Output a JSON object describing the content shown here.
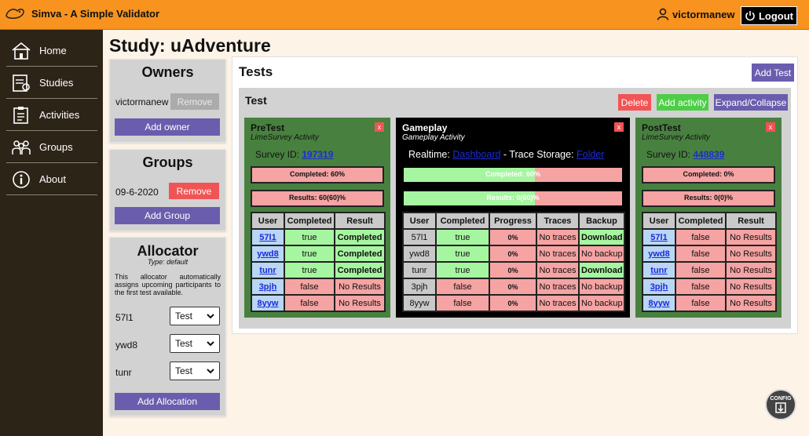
{
  "header": {
    "title": "Simva - A Simple Validator",
    "username": "victormanew",
    "logout_label": "Logout"
  },
  "sidebar": {
    "items": [
      {
        "label": "Home",
        "icon": "home-icon"
      },
      {
        "label": "Studies",
        "icon": "studies-icon"
      },
      {
        "label": "Activities",
        "icon": "activities-icon"
      },
      {
        "label": "Groups",
        "icon": "groups-icon"
      },
      {
        "label": "About",
        "icon": "about-icon"
      }
    ]
  },
  "page_title": "Study: uAdventure",
  "owners": {
    "title": "Owners",
    "owner_name": "victormanew",
    "remove_label": "Remove",
    "add_label": "Add owner"
  },
  "groups": {
    "title": "Groups",
    "group_name": "09-6-2020",
    "remove_label": "Remove",
    "add_label": "Add Group"
  },
  "allocator": {
    "title": "Allocator",
    "type": "Type: default",
    "description": "This allocator automatically assigns upcoming participants to the first test available.",
    "rows": [
      {
        "user": "57l1",
        "value": "Test"
      },
      {
        "user": "ywd8",
        "value": "Test"
      },
      {
        "user": "tunr",
        "value": "Test"
      }
    ],
    "add_label": "Add Allocation"
  },
  "tests": {
    "title": "Tests",
    "add_label": "Add Test",
    "test_name": "Test",
    "delete_label": "Delete",
    "add_activity_label": "Add activity",
    "expand_label": "Expand/Collapse",
    "pretest": {
      "title": "PreTest",
      "subtitle": "LimeSurvey Activity",
      "close": "x",
      "survey_label": "Survey ID: ",
      "survey_id": "197319",
      "completed_text": "Completed: 60%",
      "completed_fraction": 0.0,
      "results_text": "Results: 60(60)%",
      "headers": [
        "User",
        "Completed",
        "Result"
      ],
      "rows": [
        {
          "user": "57l1",
          "completed": "true",
          "result": "Completed"
        },
        {
          "user": "ywd8",
          "completed": "true",
          "result": "Completed"
        },
        {
          "user": "tunr",
          "completed": "true",
          "result": "Completed"
        },
        {
          "user": "3pjh",
          "completed": "false",
          "result": "No Results"
        },
        {
          "user": "8yyw",
          "completed": "false",
          "result": "No Results"
        }
      ]
    },
    "gameplay": {
      "title": "Gameplay",
      "subtitle": "Gameplay Activity",
      "close": "x",
      "realtime_label": "Realtime: ",
      "dashboard_link": "Dashboard",
      "storage_label": " - Trace Storage: ",
      "folder_link": "Folder",
      "completed_text": "Completed: 60%",
      "completed_fraction": 0.6,
      "results_text": "Results: 0(60)%",
      "results_fraction": 0.6,
      "headers": [
        "User",
        "Completed",
        "Progress",
        "Traces",
        "Backup"
      ],
      "rows": [
        {
          "user": "57l1",
          "completed": "true",
          "progress": "0%",
          "traces": "No traces",
          "backup": "Download"
        },
        {
          "user": "ywd8",
          "completed": "true",
          "progress": "0%",
          "traces": "No traces",
          "backup": "No backup"
        },
        {
          "user": "tunr",
          "completed": "true",
          "progress": "0%",
          "traces": "No traces",
          "backup": "Download"
        },
        {
          "user": "3pjh",
          "completed": "false",
          "progress": "0%",
          "traces": "No traces",
          "backup": "No backup"
        },
        {
          "user": "8yyw",
          "completed": "false",
          "progress": "0%",
          "traces": "No traces",
          "backup": "No backup"
        }
      ]
    },
    "posttest": {
      "title": "PostTest",
      "subtitle": "LimeSurvey Activity",
      "close": "x",
      "survey_label": "Survey ID: ",
      "survey_id": "448839",
      "completed_text": "Completed: 0%",
      "results_text": "Results: 0(0)%",
      "headers": [
        "User",
        "Completed",
        "Result"
      ],
      "rows": [
        {
          "user": "57l1",
          "completed": "false",
          "result": "No Results"
        },
        {
          "user": "ywd8",
          "completed": "false",
          "result": "No Results"
        },
        {
          "user": "tunr",
          "completed": "false",
          "result": "No Results"
        },
        {
          "user": "3pjh",
          "completed": "false",
          "result": "No Results"
        },
        {
          "user": "8yyw",
          "completed": "false",
          "result": "No Results"
        }
      ]
    }
  },
  "config_label": "CONFIG"
}
